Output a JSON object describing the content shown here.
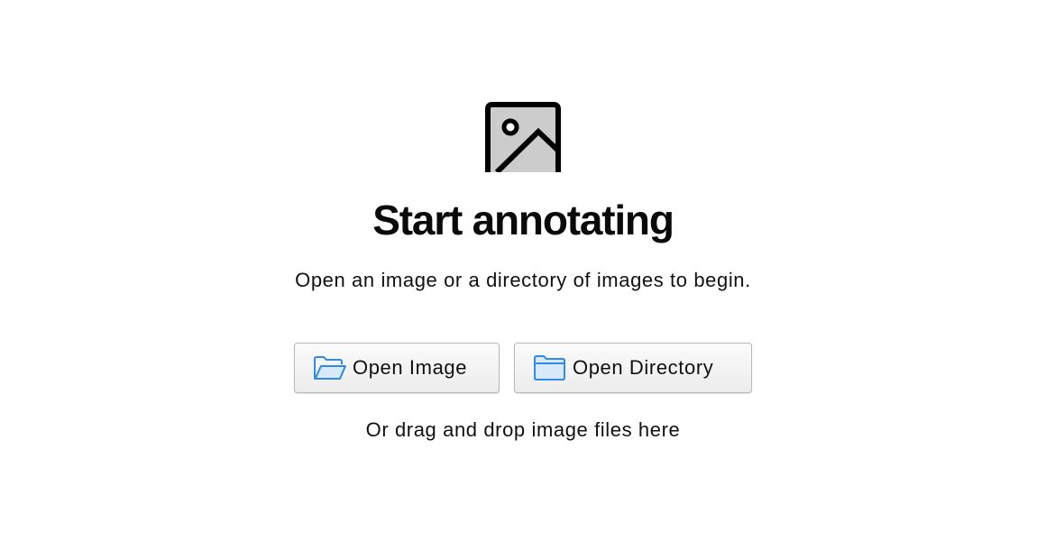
{
  "empty_state": {
    "icon": "image-placeholder-icon",
    "title": "Start annotating",
    "subtitle": "Open an image or a directory of images to begin.",
    "hint": "Or drag and drop image files here"
  },
  "buttons": {
    "open_image": {
      "label": "Open Image",
      "icon": "folder-open-icon"
    },
    "open_directory": {
      "label": "Open Directory",
      "icon": "folder-icon"
    }
  },
  "colors": {
    "background": "#ffffff",
    "text": "#111111",
    "icon_fill": "#cccccc",
    "folder_blue": "#2f8be6",
    "folder_fill": "#d7e9fb"
  }
}
